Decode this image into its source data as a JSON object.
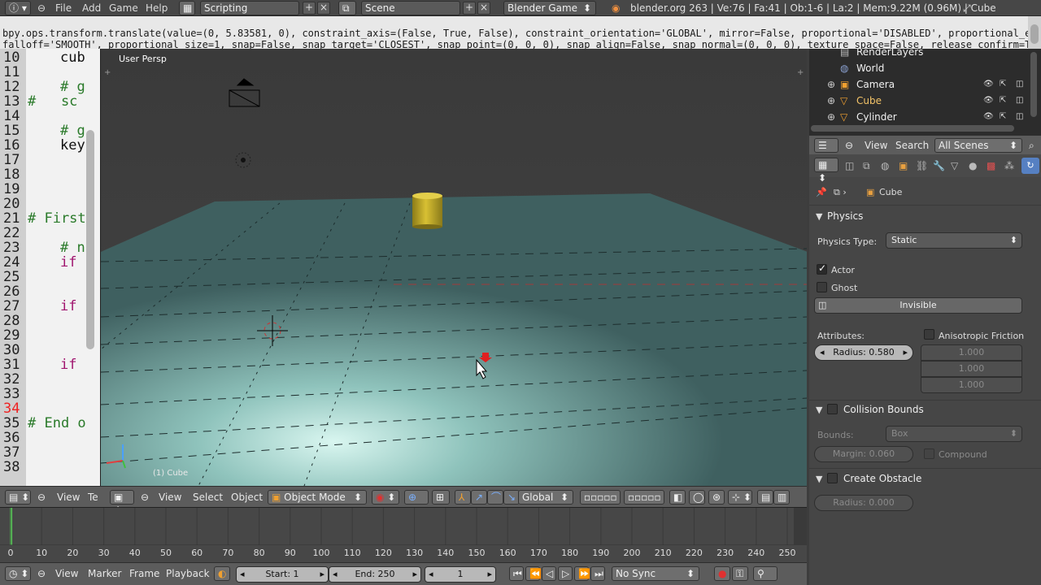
{
  "top_bar": {
    "menus": [
      "File",
      "Add",
      "Game",
      "Help"
    ],
    "screen_layout": "Scripting",
    "scene": "Scene",
    "engine": "Blender Game",
    "stats": "blender.org 263 | Ve:76 | Fa:41 | Ob:1-6 | La:2 | Mem:9.22M (0.96M) | Cube"
  },
  "info_log": {
    "line1": "bpy.ops.transform.translate(value=(0, 5.83581, 0), constraint_axis=(False, True, False), constraint_orientation='GLOBAL', mirror=False, proportional='DISABLED', proportional_edit_",
    "line2": "falloff='SMOOTH', proportional_size=1, snap=False, snap_target='CLOSEST', snap_point=(0, 0, 0), snap_align=False, snap_normal=(0, 0, 0), texture_space=False, release_confirm=True)"
  },
  "text_editor": {
    "lines": [
      {
        "n": "10",
        "text": "cub",
        "kind": "plain",
        "indent": 2
      },
      {
        "n": "11",
        "text": "",
        "kind": "plain",
        "indent": 0
      },
      {
        "n": "12",
        "text": "# g",
        "kind": "cm",
        "indent": 2
      },
      {
        "n": "13",
        "text": "#   sc",
        "kind": "cm",
        "indent": 0
      },
      {
        "n": "14",
        "text": "",
        "kind": "plain",
        "indent": 0
      },
      {
        "n": "15",
        "text": "# g",
        "kind": "cm",
        "indent": 2
      },
      {
        "n": "16",
        "text": "key",
        "kind": "plain",
        "indent": 2
      },
      {
        "n": "17",
        "text": "",
        "kind": "plain",
        "indent": 0
      },
      {
        "n": "18",
        "text": "",
        "kind": "plain",
        "indent": 0
      },
      {
        "n": "19",
        "text": "",
        "kind": "plain",
        "indent": 0
      },
      {
        "n": "20",
        "text": "",
        "kind": "plain",
        "indent": 0
      },
      {
        "n": "21",
        "text": "# First",
        "kind": "cm",
        "indent": 0
      },
      {
        "n": "22",
        "text": "",
        "kind": "plain",
        "indent": 0
      },
      {
        "n": "23",
        "text": "# n",
        "kind": "cm",
        "indent": 2
      },
      {
        "n": "24",
        "text": "if",
        "kind": "kw",
        "indent": 2
      },
      {
        "n": "25",
        "text": "",
        "kind": "plain",
        "indent": 0
      },
      {
        "n": "26",
        "text": "",
        "kind": "plain",
        "indent": 0
      },
      {
        "n": "27",
        "text": "if",
        "kind": "kw",
        "indent": 2
      },
      {
        "n": "28",
        "text": "",
        "kind": "plain",
        "indent": 0
      },
      {
        "n": "29",
        "text": "",
        "kind": "plain",
        "indent": 0
      },
      {
        "n": "30",
        "text": "",
        "kind": "plain",
        "indent": 0
      },
      {
        "n": "31",
        "text": "if",
        "kind": "kw",
        "indent": 2
      },
      {
        "n": "32",
        "text": "",
        "kind": "plain",
        "indent": 0
      },
      {
        "n": "33",
        "text": "",
        "kind": "plain",
        "indent": 0
      },
      {
        "n": "34",
        "text": "",
        "kind": "plain",
        "indent": 0,
        "current": true
      },
      {
        "n": "35",
        "text": "# End o",
        "kind": "cm",
        "indent": 0
      },
      {
        "n": "36",
        "text": "",
        "kind": "plain",
        "indent": 0
      },
      {
        "n": "37",
        "text": "",
        "kind": "plain",
        "indent": 0
      },
      {
        "n": "38",
        "text": "",
        "kind": "plain",
        "indent": 0
      }
    ],
    "header_view": "View",
    "header_text": "Te"
  },
  "viewport": {
    "label": "User Persp",
    "object_label": "(1) Cube",
    "header": {
      "view": "View",
      "select": "Select",
      "object": "Object",
      "mode": "Object Mode",
      "orientation": "Global"
    }
  },
  "timeline": {
    "ticks": [
      "0",
      "10",
      "20",
      "30",
      "40",
      "50",
      "60",
      "70",
      "80",
      "90",
      "100",
      "110",
      "120",
      "130",
      "140",
      "150",
      "160",
      "170",
      "180",
      "190",
      "200",
      "210",
      "220",
      "230",
      "240",
      "250"
    ],
    "header": {
      "view": "View",
      "marker": "Marker",
      "frame": "Frame",
      "playback": "Playback",
      "start": "Start: 1",
      "end": "End: 250",
      "current": "1",
      "sync": "No Sync"
    }
  },
  "outliner": {
    "rows": [
      {
        "label": "RenderLayers",
        "icon": "render-layers-icon"
      },
      {
        "label": "World",
        "icon": "world-icon"
      },
      {
        "label": "Camera",
        "icon": "camera-icon"
      },
      {
        "label": "Cube",
        "icon": "mesh-icon"
      },
      {
        "label": "Cylinder",
        "icon": "mesh-icon"
      }
    ],
    "header": {
      "view": "View",
      "search": "Search",
      "filter": "All Scenes"
    }
  },
  "properties": {
    "context_object": "Cube",
    "physics": {
      "title": "Physics",
      "type_label": "Physics Type:",
      "type_value": "Static",
      "actor": "Actor",
      "ghost": "Ghost",
      "invisible": "Invisible",
      "attributes": "Attributes:",
      "aniso": "Anisotropic Friction",
      "radius": "Radius: 0.580",
      "aniso_values": [
        "1.000",
        "1.000",
        "1.000"
      ]
    },
    "collision": {
      "title": "Collision Bounds",
      "bounds_label": "Bounds:",
      "bounds_value": "Box",
      "margin": "Margin: 0.060",
      "compound": "Compound"
    },
    "obstacle": {
      "title": "Create Obstacle",
      "radius": "Radius: 0.000"
    }
  },
  "colors": {
    "accent_blue": "#5680c2",
    "cube_highlight": "#f4c468",
    "cylinder_yellow": "#c9b22e"
  }
}
